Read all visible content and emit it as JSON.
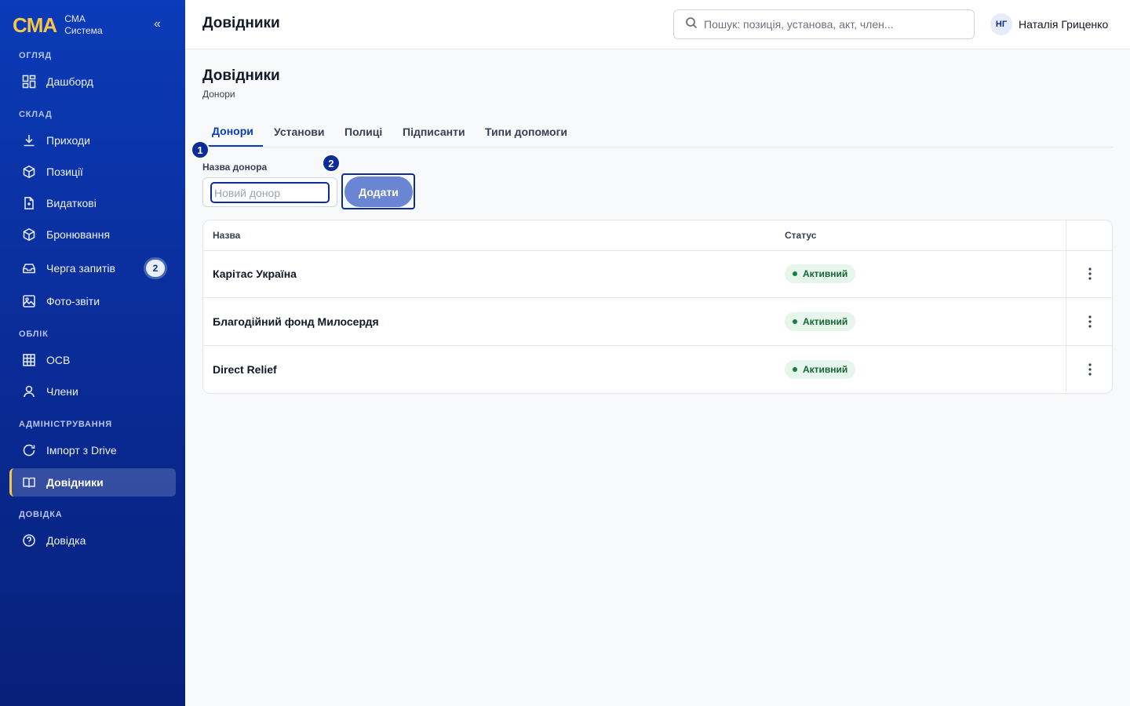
{
  "brand": {
    "logo": "CMA",
    "line1": "CMA",
    "line2": "Система",
    "collapse": "«"
  },
  "sidebar": {
    "sections": {
      "overview": "ОГЛЯД",
      "warehouse": "СКЛАД",
      "accounting": "ОБЛІК",
      "admin": "АДМІНІСТРУВАННЯ",
      "help": "ДОВІДКА"
    },
    "items": [
      {
        "label": "Дашборд",
        "icon": "dashboard-icon"
      },
      {
        "label": "Приходи",
        "icon": "download-icon"
      },
      {
        "label": "Позиції",
        "icon": "box-icon"
      },
      {
        "label": "Видаткові",
        "icon": "document-icon"
      },
      {
        "label": "Бронювання",
        "icon": "box-icon"
      },
      {
        "label": "Черга запитів",
        "icon": "inbox-icon",
        "badge": "2"
      },
      {
        "label": "Фото-звіти",
        "icon": "image-icon"
      },
      {
        "label": "ОСВ",
        "icon": "grid-icon"
      },
      {
        "label": "Члени",
        "icon": "user-icon"
      },
      {
        "label": "Імпорт з Drive",
        "icon": "refresh-icon"
      },
      {
        "label": "Довідники",
        "icon": "book-icon",
        "active": true
      },
      {
        "label": "Довідка",
        "icon": "help-icon"
      }
    ]
  },
  "header": {
    "title": "Довідники",
    "search_placeholder": "Пошук: позиція, установа, акт, член...",
    "user_initials": "НГ",
    "user_name": "Наталія Гриценко"
  },
  "page": {
    "title": "Довідники",
    "subtitle": "Донори",
    "tabs": [
      "Донори",
      "Установи",
      "Полиці",
      "Підписанти",
      "Типи допомоги"
    ],
    "active_tab": "Донори"
  },
  "form": {
    "step1": "1",
    "step2": "2",
    "label": "Назва донора",
    "placeholder": "Новий донор",
    "value": "",
    "add_label": "Додати"
  },
  "table": {
    "columns": [
      "Назва",
      "Статус"
    ],
    "rows": [
      {
        "name": "Карітас Україна",
        "status": "Активний"
      },
      {
        "name": "Благодійний фонд Милосердя",
        "status": "Активний"
      },
      {
        "name": "Direct Relief",
        "status": "Активний"
      }
    ]
  },
  "colors": {
    "sidebar": "#0a3bb8",
    "accent": "#f5c64a",
    "primary": "#0a2d9a",
    "status_bg": "#e6f6ec",
    "status_text": "#166534"
  }
}
